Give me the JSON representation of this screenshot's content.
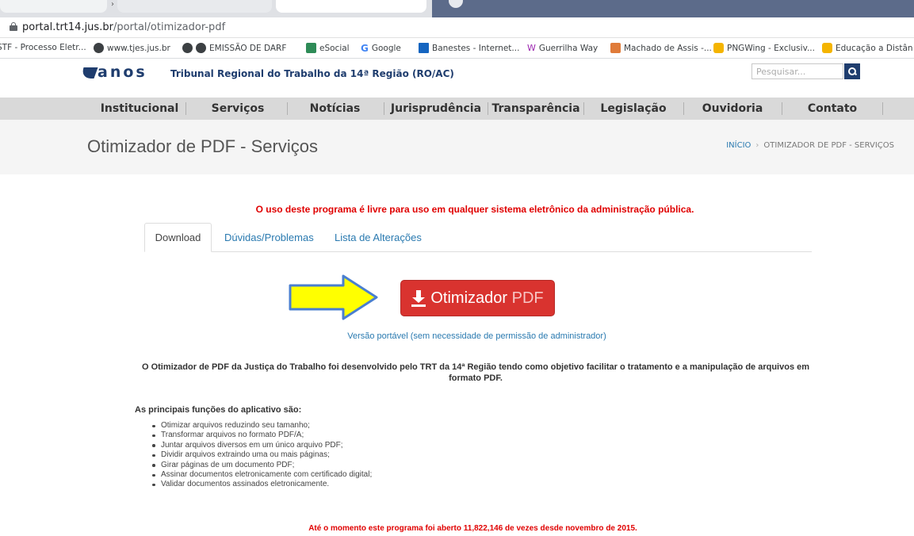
{
  "browser": {
    "url_host": "portal.trt14.jus.br",
    "url_path": "/portal/otimizador-pdf"
  },
  "bookmarks": [
    {
      "label": "STF - Processo Eletr...",
      "icon": "stf-icon"
    },
    {
      "label": "www.tjes.jus.br",
      "icon": "globe-icon"
    },
    {
      "label": "EMISSÃO DE DARF",
      "icon": "globe-icon"
    },
    {
      "label": "eSocial",
      "icon": "esocial-icon"
    },
    {
      "label": "Google",
      "icon": "google-icon"
    },
    {
      "label": "Banestes - Internet...",
      "icon": "banestes-icon"
    },
    {
      "label": "Guerrilha Way",
      "icon": "guerrilha-icon"
    },
    {
      "label": "Machado de Assis -...",
      "icon": "machado-icon"
    },
    {
      "label": "PNGWing - Exclusiv...",
      "icon": "pngwing-icon"
    },
    {
      "label": "Educação a Distân",
      "icon": "pngwing-icon"
    }
  ],
  "header": {
    "logo_anos": "anos",
    "logo_title": "Tribunal Regional do Trabalho da 14ª Região (RO/AC)",
    "search_placeholder": "Pesquisar..."
  },
  "nav": {
    "items": [
      "Institucional",
      "Serviços",
      "Notícias",
      "Jurisprudência",
      "Transparência",
      "Legislação",
      "Ouvidoria",
      "Contato"
    ]
  },
  "title_band": {
    "page_title": "Otimizador de PDF - Serviços",
    "breadcrumb_home": "INÍCIO",
    "breadcrumb_sep": "›",
    "breadcrumb_current": "OTIMIZADOR DE PDF - SERVIÇOS"
  },
  "content": {
    "notice": "O uso deste programa é livre para uso em qualquer sistema eletrônico da administração pública.",
    "tabs": [
      "Download",
      "Dúvidas/Problemas",
      "Lista de Alterações"
    ],
    "download_label": "Otimizador",
    "download_suffix": "PDF",
    "portable_link": "Versão portável (sem necessidade de permissão de administrador)",
    "description": "O Otimizador de PDF da Justiça do Trabalho foi desenvolvido pelo TRT da 14ª Região tendo como objetivo facilitar o tratamento e a manipulação de arquivos em formato PDF.",
    "functions_title": "As principais funções do aplicativo são:",
    "functions": [
      "Otimizar arquivos reduzindo seu tamanho;",
      "Transformar arquivos no formato PDF/A;",
      "Juntar arquivos diversos em um único arquivo PDF;",
      "Dividir arquivos extraindo uma ou mais páginas;",
      "Girar páginas de um documento PDF;",
      "Assinar documentos eletronicamente com certificado digital;",
      "Validar documentos assinados eletronicamente."
    ],
    "counter": "Até o momento este programa foi aberto 11,822,146 de vezes desde novembro de 2015."
  },
  "colors": {
    "brand_blue": "#1f3d6e",
    "download_red": "#d9332f",
    "notice_red": "#e00000",
    "link_blue": "#2a7ab0",
    "arrow_yellow": "#ffff00"
  }
}
